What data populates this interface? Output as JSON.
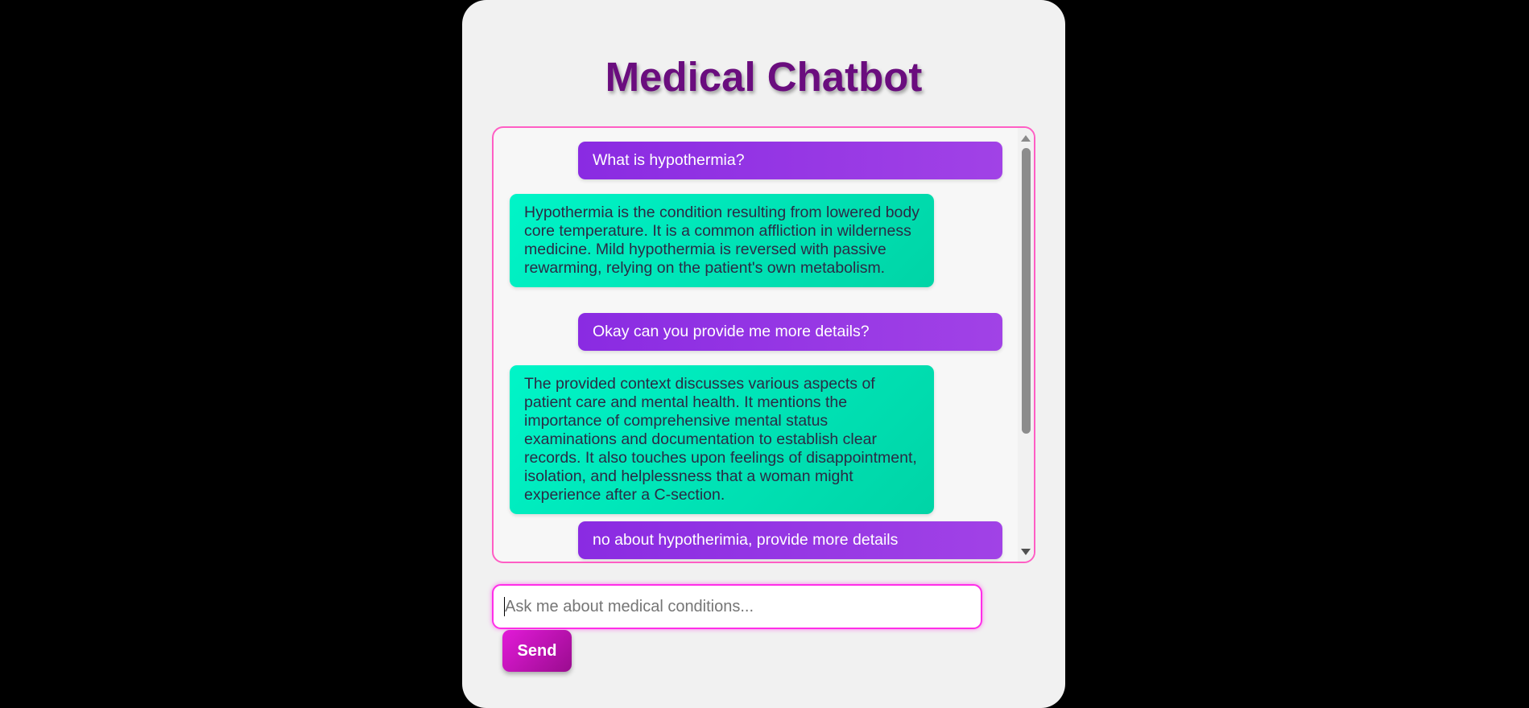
{
  "app": {
    "title": "Medical Chatbot"
  },
  "chat": {
    "messages": [
      {
        "role": "user",
        "text": "What is hypothermia?"
      },
      {
        "role": "bot",
        "text": "Hypothermia is the condition resulting from lowered body core temperature. It is a common affliction in wilderness medicine. Mild hypothermia is reversed with passive rewarming, relying on the patient's own metabolism."
      },
      {
        "role": "user",
        "text": "Okay can you provide me more details?"
      },
      {
        "role": "bot",
        "text": "The provided context discusses various aspects of patient care and mental health. It mentions the importance of comprehensive mental status examinations and documentation to establish clear records. It also touches upon feelings of disappointment, isolation, and helplessness that a woman might experience after a C-section."
      },
      {
        "role": "user",
        "text": "no about hypotherimia, provide more details"
      }
    ]
  },
  "input": {
    "placeholder": "Ask me about medical conditions...",
    "value": ""
  },
  "send": {
    "label": "Send"
  },
  "colors": {
    "title": "#6a0d7e",
    "user_bubble": "#8a2be2",
    "bot_bubble": "#00e6b8",
    "border_accent": "#ff5ec4",
    "send_button": "#d414c9"
  },
  "icons": {
    "scroll_up": "triangle-up-icon",
    "scroll_down": "triangle-down-icon"
  }
}
